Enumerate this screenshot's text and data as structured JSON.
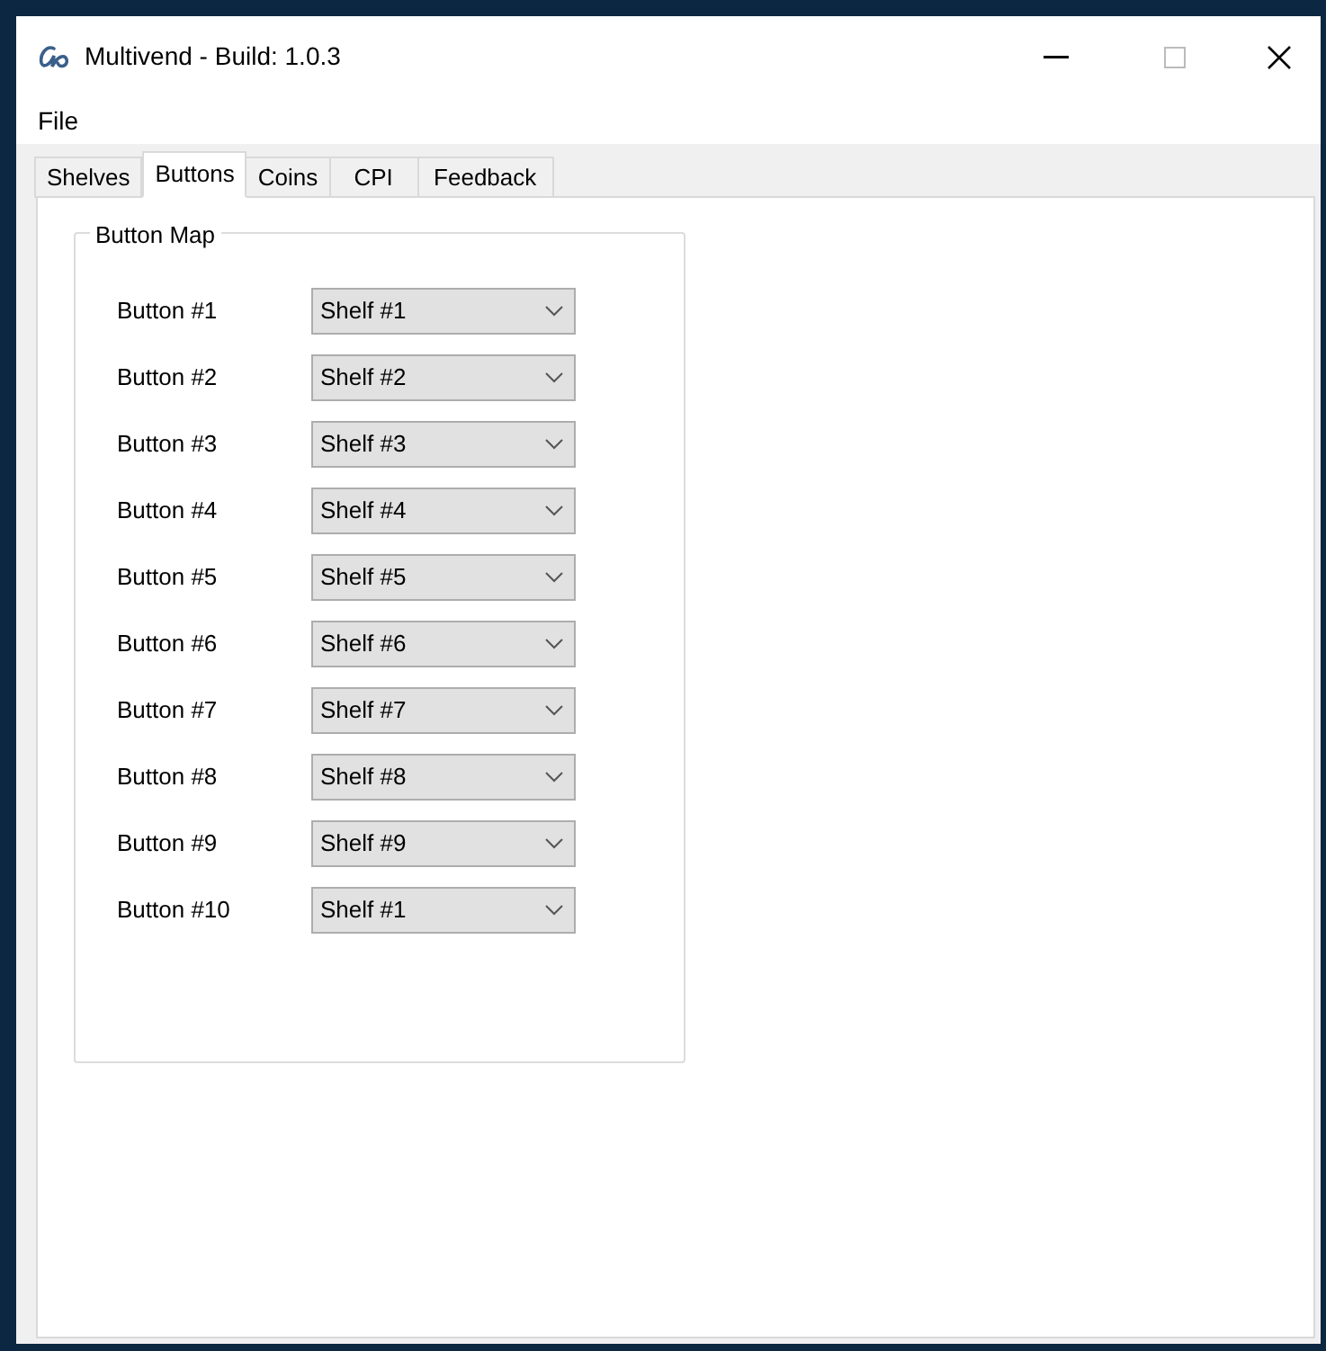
{
  "window": {
    "title": "Multivend - Build: 1.0.3"
  },
  "menu": [
    "File"
  ],
  "tabs": [
    {
      "label": "Shelves",
      "selected": false
    },
    {
      "label": "Buttons",
      "selected": true
    },
    {
      "label": "Coins",
      "selected": false
    },
    {
      "label": "CPI",
      "selected": false
    },
    {
      "label": "Feedback",
      "selected": false
    }
  ],
  "group": {
    "title": "Button Map",
    "rows": [
      {
        "label": "Button #1",
        "value": "Shelf #1"
      },
      {
        "label": "Button #2",
        "value": "Shelf #2"
      },
      {
        "label": "Button #3",
        "value": "Shelf #3"
      },
      {
        "label": "Button #4",
        "value": "Shelf #4"
      },
      {
        "label": "Button #5",
        "value": "Shelf #5"
      },
      {
        "label": "Button #6",
        "value": "Shelf #6"
      },
      {
        "label": "Button #7",
        "value": "Shelf #7"
      },
      {
        "label": "Button #8",
        "value": "Shelf #8"
      },
      {
        "label": "Button #9",
        "value": "Shelf #9"
      },
      {
        "label": "Button #10",
        "value": "Shelf #1"
      }
    ]
  }
}
